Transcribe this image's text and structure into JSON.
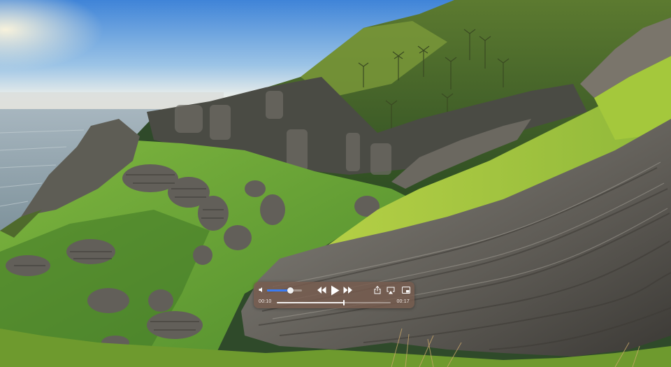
{
  "player": {
    "time_current": "00:10",
    "time_remaining": "00:17",
    "playback_fraction": 0.59,
    "volume_fraction": 0.66,
    "icons": {
      "volume": "speaker-icon",
      "rewind": "rewind-icon",
      "play": "play-icon",
      "fast_forward": "fast-forward-icon",
      "share": "share-icon",
      "airplay": "airplay-icon",
      "pip": "picture-in-picture-icon"
    },
    "colors": {
      "hud_background": "#765c4e",
      "volume_accent": "#3a7bf2"
    }
  }
}
